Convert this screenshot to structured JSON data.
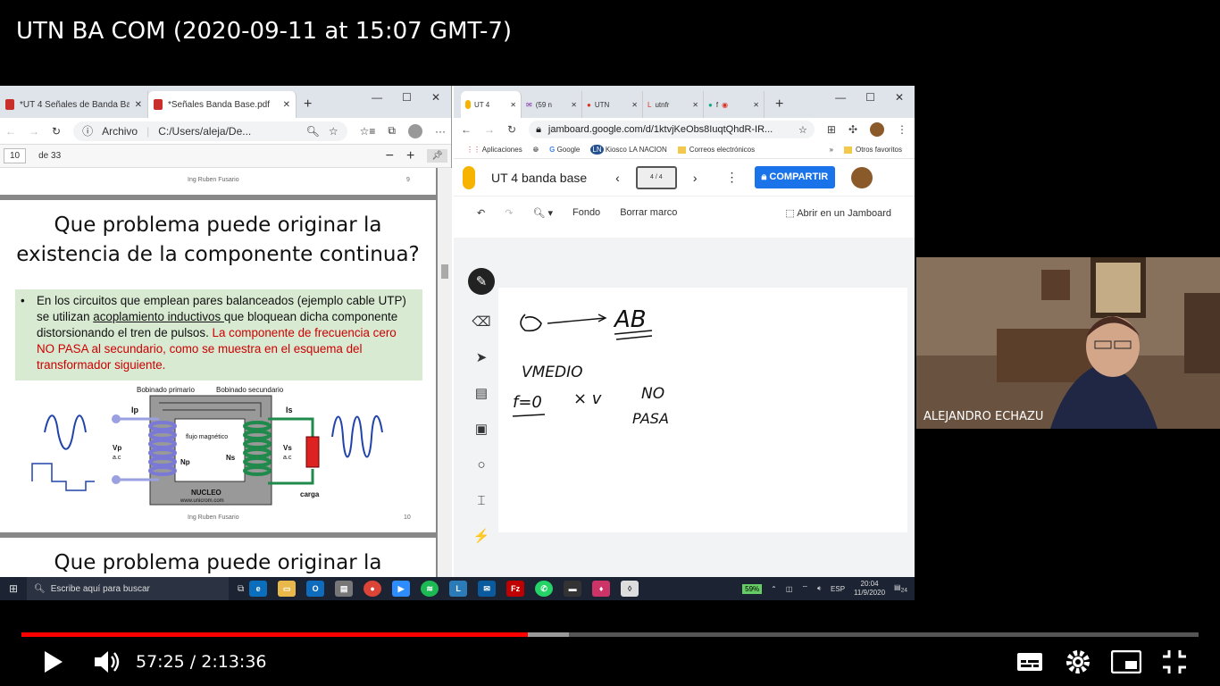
{
  "video": {
    "title": "UTN BA COM (2020-09-11 at 15:07 GMT-7)",
    "current_time": "57:25",
    "duration": "2:13:36",
    "progress": 0.43,
    "buffered": 0.465,
    "accent": "#ff0000"
  },
  "left_browser": {
    "tabs": [
      {
        "label": "*UT 4 Señales de Banda Base"
      },
      {
        "label": "*Señales Banda Base.pdf"
      }
    ],
    "archivo": "Archivo",
    "url": "C:/Users/aleja/De...",
    "page_number": "10",
    "page_total": "de 33"
  },
  "pdf": {
    "footer1": "Ing Ruben Fusario",
    "page1": "9",
    "slide_title": "Que problema puede originar la existencia de la componente continua?",
    "bullet_a": "En los circuitos que emplean pares balanceados (ejemplo cable UTP) se utilizan ",
    "bullet_u": "acoplamiento inductivos ",
    "bullet_b": "que bloquean dicha componente distorsionando el tren de pulsos. ",
    "bullet_red": "La componente de frecuencia cero NO PASA al secundario, como se muestra en el esquema del transformador siguiente.",
    "diagram": {
      "primary": "Bobinado primario",
      "secondary": "Bobinado secundario",
      "ip": "Ip",
      "is": "Is",
      "vp": "Vp",
      "vp2": "a.c",
      "np": "Np",
      "ns": "Ns",
      "vs": "Vs",
      "vs2": "a.c",
      "flux": "flujo magnético",
      "core": "NUCLEO",
      "site": "www.unicrom.com",
      "load": "carga"
    },
    "footer2": "Ing Ruben Fusario",
    "page2": "10",
    "next_title": "Que problema puede originar la"
  },
  "right_browser": {
    "tabs": [
      {
        "label": "UT 4"
      },
      {
        "label": "(59 n"
      },
      {
        "label": "UTN"
      },
      {
        "label": "utnfr"
      },
      {
        "label": "f"
      }
    ],
    "url": "jamboard.google.com/d/1ktvjKeObs8IuqtQhdR-IR...",
    "bookmarks": [
      "Aplicaciones",
      "Google",
      "Kiosco LA NACION",
      "Correos electrónicos",
      "Otros favoritos"
    ],
    "jam_title": "UT 4 banda base",
    "frame": "4 / 4",
    "share": "COMPARTIR",
    "tool_bg": "Fondo",
    "tool_clear": "Borrar marco",
    "tool_open": "Abrir en un Jamboard"
  },
  "handwriting": {
    "a": "AB",
    "vm": "VMEDIO",
    "f0": "f=0",
    "xv": "× v",
    "no": "NO",
    "pasa": "PASA"
  },
  "taskbar": {
    "search": "Escribe aquí para buscar",
    "battery": "59%",
    "lang": "ESP",
    "time": "20:04",
    "date": "11/9/2020",
    "notif": "24"
  },
  "webcam": {
    "name": "ALEJANDRO ECHAZU"
  }
}
